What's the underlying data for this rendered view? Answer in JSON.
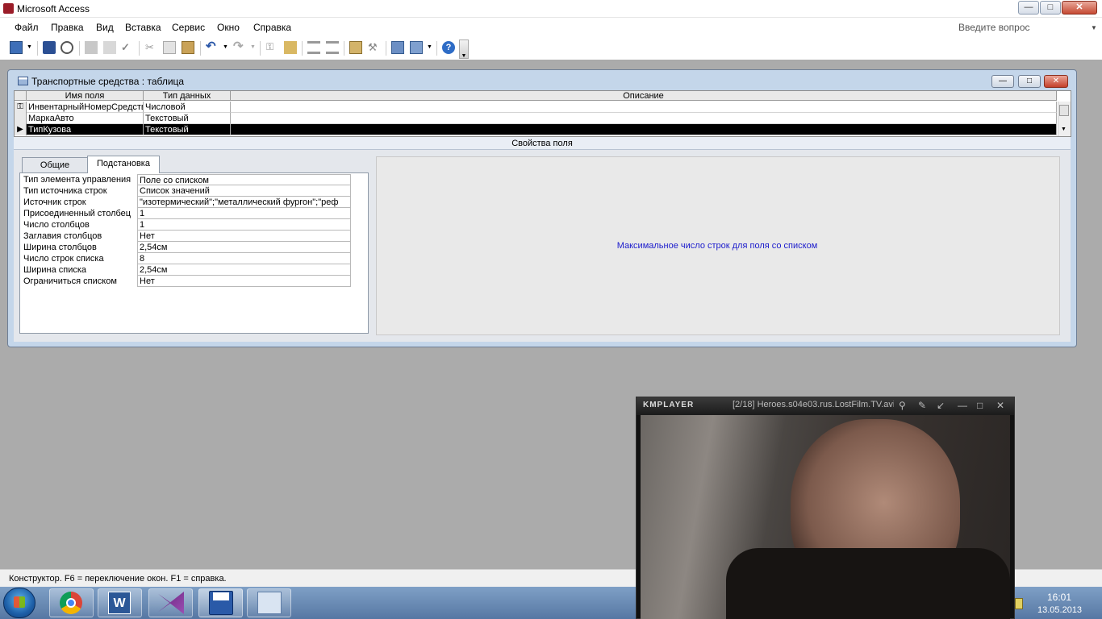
{
  "window": {
    "title": "Microsoft Access",
    "buttons": {
      "minimize": "—",
      "maximize": "□",
      "close": "✕"
    }
  },
  "menu": {
    "items": [
      "Файл",
      "Правка",
      "Вид",
      "Вставка",
      "Сервис",
      "Окно",
      "Справка"
    ],
    "ask_placeholder": "Введите вопрос"
  },
  "toolbar": {
    "icons": [
      "view-icon",
      "save-icon",
      "search-icon",
      "print-icon",
      "print-preview-icon",
      "spelling-icon",
      "cut-icon",
      "copy-icon",
      "paste-icon",
      "undo-icon",
      "redo-icon",
      "primary-key-icon",
      "build-icon",
      "insert-rows-icon",
      "delete-rows-icon",
      "properties-icon",
      "build2-icon",
      "database-window-icon",
      "new-object-icon",
      "help-icon"
    ]
  },
  "table_window": {
    "title": "Транспортные средства : таблица",
    "columns": {
      "field": "Имя поля",
      "type": "Тип данных",
      "desc": "Описание"
    },
    "rows": [
      {
        "field": "ИнвентарныйНомерСредства",
        "type": "Числовой",
        "desc": ""
      },
      {
        "field": "МаркаАвто",
        "type": "Текстовый",
        "desc": ""
      },
      {
        "field": "ТипКузова",
        "type": "Текстовый",
        "desc": ""
      }
    ],
    "properties_label": "Свойства поля",
    "tabs": [
      "Общие",
      "Подстановка"
    ],
    "active_tab": "Подстановка",
    "properties": [
      {
        "label": "Тип элемента управления",
        "value": "Поле со списком"
      },
      {
        "label": "Тип источника строк",
        "value": "Список значений"
      },
      {
        "label": "Источник строк",
        "value": "\"изотермический\";\"металлический фургон\";\"реф"
      },
      {
        "label": "Присоединенный столбец",
        "value": "1"
      },
      {
        "label": "Число столбцов",
        "value": "1"
      },
      {
        "label": "Заглавия столбцов",
        "value": "Нет"
      },
      {
        "label": "Ширина столбцов",
        "value": "2,54см"
      },
      {
        "label": "Число строк списка",
        "value": "8"
      },
      {
        "label": "Ширина списка",
        "value": "2,54см"
      },
      {
        "label": "Ограничиться списком",
        "value": "Нет"
      }
    ],
    "help_text": "Максимальное число строк для поля со списком"
  },
  "statusbar": {
    "text": "Конструктор.  F6 = переключение окон.  F1 = справка."
  },
  "kmplayer": {
    "logo": "KMPLAYER",
    "title": "[2/18] Heroes.s04e03.rus.LostFilm.TV.avi"
  },
  "taskbar": {
    "apps": [
      "chrome-icon",
      "word-icon",
      "visual-studio-icon",
      "access-icon",
      "windows-explorer-icon"
    ],
    "time": "16:01",
    "date": "13.05.2013"
  }
}
